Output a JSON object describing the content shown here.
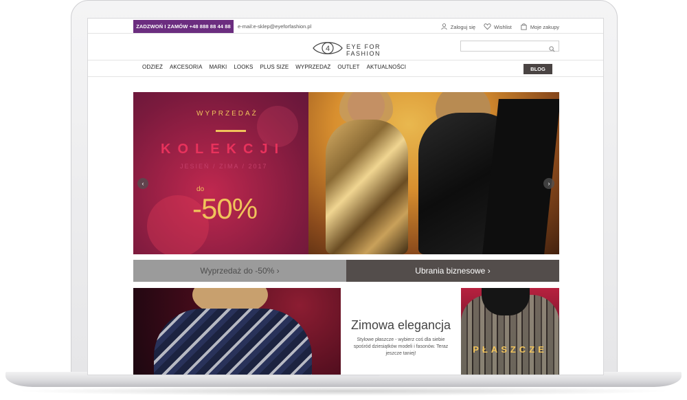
{
  "topbar": {
    "call_label": "ZADZWOŃ I ZAMÓW +48 888 88 44 88",
    "email": "e-mail:e-sklep@eyeforfashion.pl",
    "login": "Zaloguj się",
    "wishlist": "Wishlist",
    "cart": "Moje zakupy"
  },
  "logo": {
    "line1": "EYE FOR",
    "line2": "FASHION",
    "mark": "4"
  },
  "search": {
    "placeholder": ""
  },
  "nav": {
    "items": [
      "ODZIEŻ",
      "AKCESORIA",
      "MARKI",
      "LOOKS",
      "PLUS SIZE",
      "WYPRZEDAŻ",
      "OUTLET",
      "AKTUALNOŚCI"
    ],
    "blog": "BLOG"
  },
  "hero": {
    "title": "WYPRZEDAŻ",
    "kolekcji": "KOLEKCJI",
    "season": "JESIEŃ / ZIMA / 2017",
    "do": "do",
    "percent": "-50%",
    "prev": "‹",
    "next": "›"
  },
  "categories": {
    "left": "Wyprzedaż do -50%  ›",
    "right": "Ubrania biznesowe  ›"
  },
  "tiles": {
    "middle_title": "Zimowa elegancja",
    "middle_text": "Stylowe płaszcze - wybierz coś dla siebie spośród dziesiątków modeli i fasonów. Teraz jeszcze taniej!",
    "right_label": "PŁASZCZE"
  }
}
